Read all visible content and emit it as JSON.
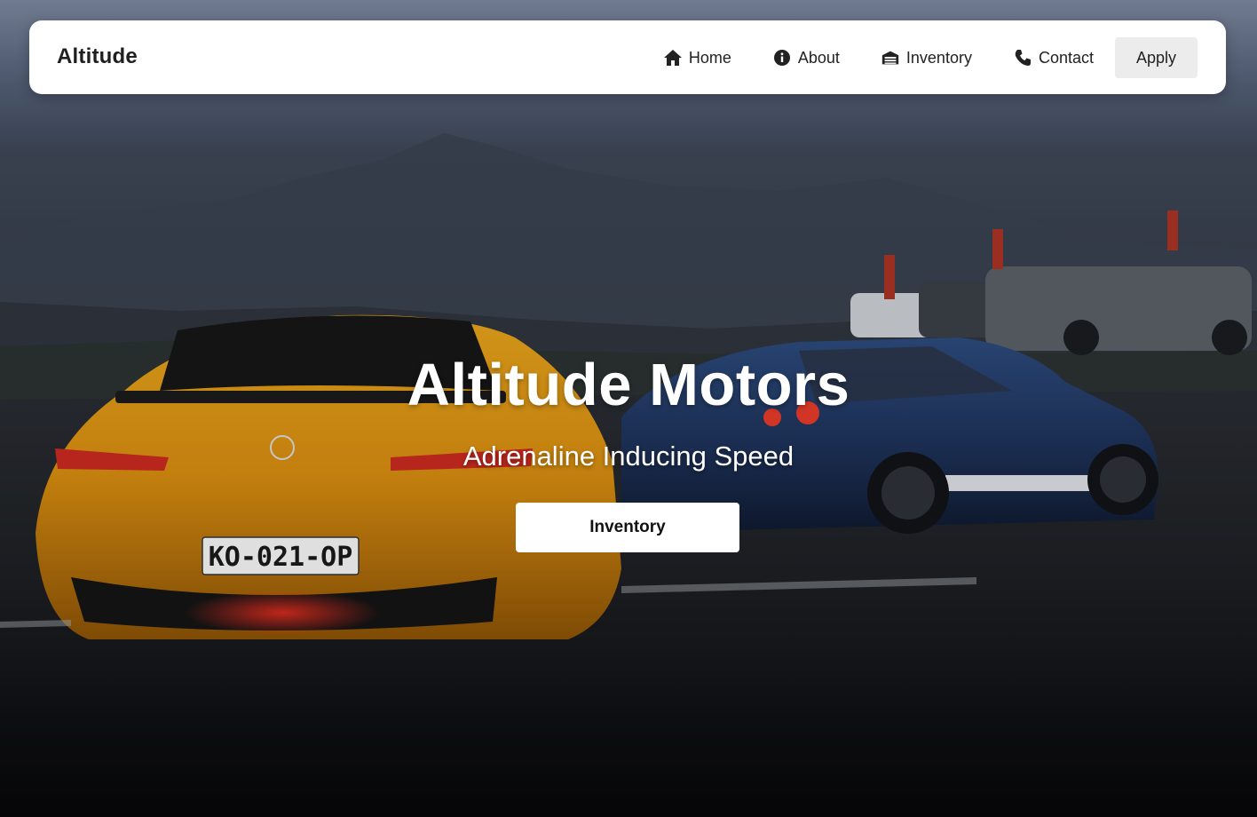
{
  "navbar": {
    "brand": "Altitude",
    "links": [
      {
        "label": "Home",
        "icon": "home-icon"
      },
      {
        "label": "About",
        "icon": "info-icon"
      },
      {
        "label": "Inventory",
        "icon": "garage-icon"
      },
      {
        "label": "Contact",
        "icon": "phone-icon"
      }
    ],
    "apply_label": "Apply"
  },
  "hero": {
    "title": "Altitude Motors",
    "subtitle": "Adrenaline Inducing Speed",
    "cta_label": "Inventory",
    "background_image": "car-photo",
    "plate_text": "KO-021-OP"
  },
  "colors": {
    "navbar_bg": "#ffffff",
    "apply_bg": "#ececec",
    "text_dark": "#222222",
    "hero_text": "#ffffff",
    "cta_bg": "#ffffff"
  }
}
